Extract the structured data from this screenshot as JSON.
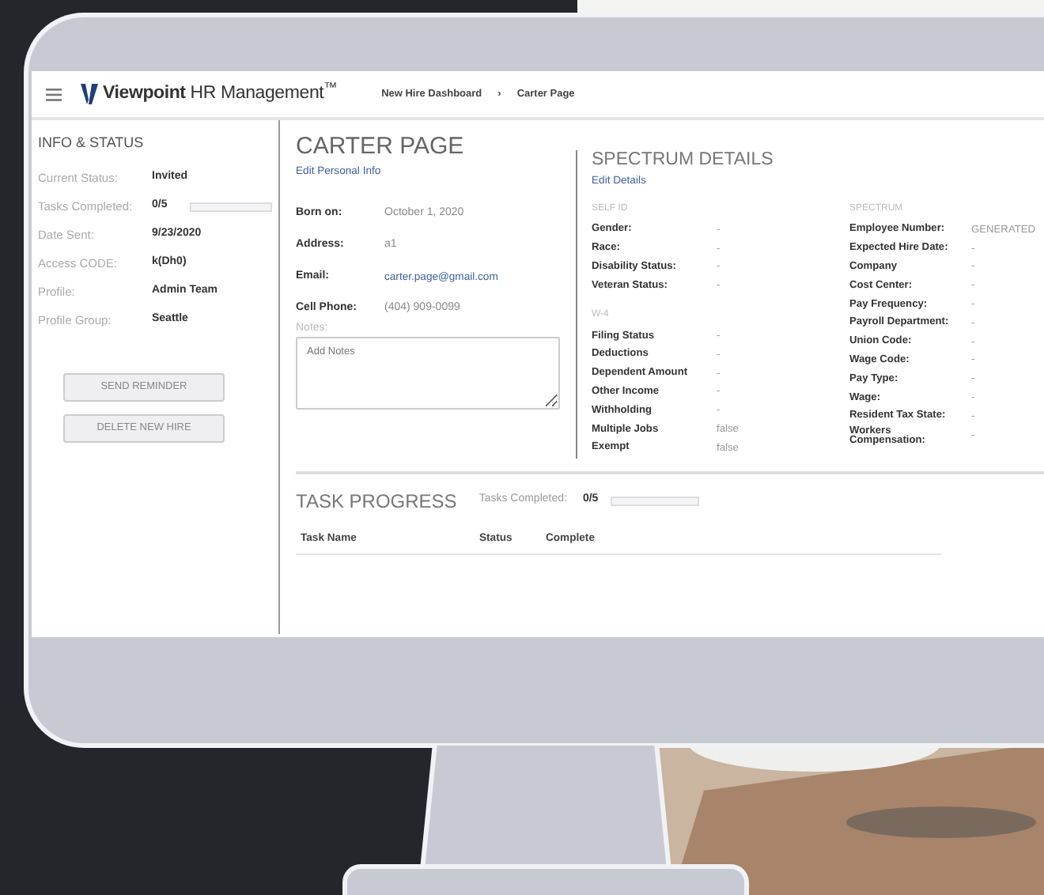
{
  "nav": {
    "brand": "**Viewpoint** HR Management$^{™}$",
    "breadcrumb": [
      "New Hire Dashboard",
      "Carter Page"
    ],
    "separator": "›"
  },
  "sidebar": {
    "title": "INFO & STATUS",
    "rows": [
      {
        "kind": "text",
        "label": "Current Status:",
        "value": "Invited"
      },
      {
        "kind": "progress",
        "label": "Tasks Completed:",
        "value": "0/5",
        "level": 0
      },
      {
        "kind": "text",
        "label": "Date Sent:",
        "value": "9/23/2020"
      },
      {
        "kind": "text",
        "label": "Access CODE:",
        "value": "k(Dh0)"
      },
      {
        "kind": "text",
        "label": "Profile:",
        "value": "Admin Team"
      },
      {
        "kind": "text",
        "label": "Profile Group:",
        "value": "Seattle"
      }
    ],
    "buttons": [
      "SEND REMINDER",
      "DELETE NEW HIRE"
    ]
  },
  "profile": {
    "name": "CARTER PAGE",
    "edit_link": "Edit Personal Info",
    "fields": [
      {
        "kind": "text",
        "label": "Born on:",
        "value": "October 1, 2020"
      },
      {
        "kind": "text",
        "label": "Address:",
        "value": "a1"
      },
      {
        "kind": "link",
        "label": "Email:",
        "value": "carter.page@gmail.com"
      },
      {
        "kind": "text",
        "label": "Cell Phone:",
        "value": "(404) 909-0099"
      }
    ],
    "notes_label": "Notes:",
    "notes_placeholder": "Add Notes"
  },
  "spectrum_details": {
    "title": "SPECTRUM DETAILS",
    "edit_link": "Edit Details",
    "self_id": {
      "heading": "SELF ID",
      "rows": [
        {
          "label": "Gender:",
          "value": "-"
        },
        {
          "label": "Race:",
          "value": "-"
        },
        {
          "label": "Disability Status:",
          "value": "-"
        },
        {
          "label": "Veteran Status:",
          "value": "-"
        }
      ]
    },
    "w4": {
      "heading": "W-4",
      "rows": [
        {
          "label": "Filing Status",
          "value": "-"
        },
        {
          "label": "Deductions",
          "value": "-"
        },
        {
          "label": "Dependent Amount",
          "value": "-"
        },
        {
          "label": "Other Income",
          "value": "-"
        },
        {
          "label": "Withholding",
          "value": "-"
        },
        {
          "label": "Multiple Jobs",
          "value": "false"
        },
        {
          "label": "Exempt",
          "value": "false"
        }
      ]
    },
    "spectrum": {
      "heading": "SPECTRUM",
      "rows": [
        {
          "label": "Employee Number:",
          "value": "GENERATED"
        },
        {
          "label": "Expected Hire Date:",
          "value": "-"
        },
        {
          "label": "Company",
          "value": "-"
        },
        {
          "label": "Cost Center:",
          "value": "-"
        },
        {
          "label": "Pay Frequency:",
          "value": "-"
        },
        {
          "label": "Payroll Department:",
          "value": "-"
        },
        {
          "label": "Union Code:",
          "value": "-"
        },
        {
          "label": "Wage Code:",
          "value": "-"
        },
        {
          "label": "Pay Type:",
          "value": "-"
        },
        {
          "label": "Wage:",
          "value": "-"
        },
        {
          "label": "Resident Tax State:",
          "value": "-"
        },
        {
          "label": "Workers Compensation:",
          "value": "-"
        }
      ]
    }
  },
  "task_progress": {
    "title": "TASK PROGRESS",
    "completed_label": "Tasks Completed:",
    "completed_value": "0/5",
    "level": 0,
    "columns": [
      "Task Name",
      "Status",
      "Complete"
    ]
  }
}
